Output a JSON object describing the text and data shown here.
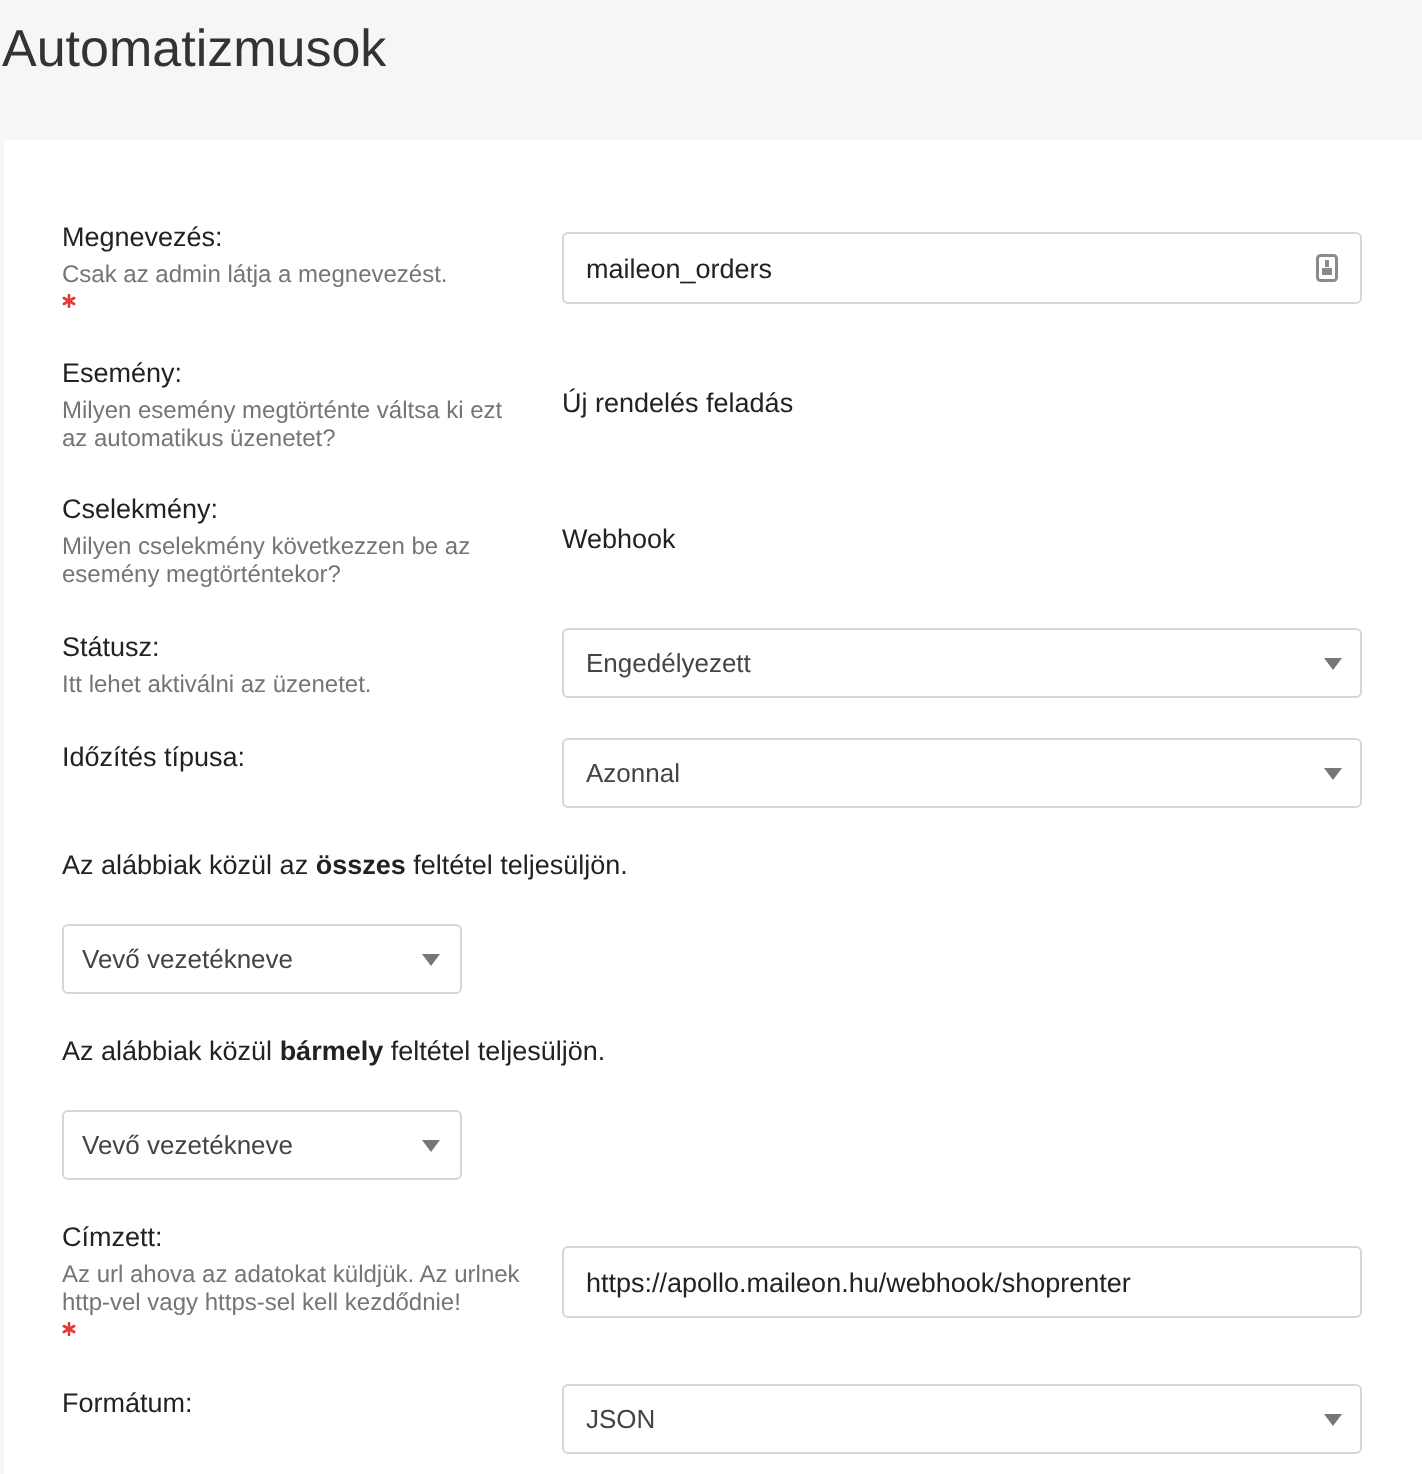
{
  "page": {
    "title": "Automatizmusok"
  },
  "form": {
    "rows": [
      {
        "kind": "text_input",
        "label": "Megnevezés:",
        "description": "Csak az admin látja a megnevezést.",
        "required": true,
        "value": "maileon_orders",
        "autofill_icon": true
      },
      {
        "kind": "static",
        "label": "Esemény:",
        "description": "Milyen esemény megtörténte váltsa ki ezt az automatikus üzenetet?",
        "required": false,
        "value": "Új rendelés feladás"
      },
      {
        "kind": "static",
        "label": "Cselekmény:",
        "description": "Milyen cselekmény következzen be az esemény megtörténtekor?",
        "required": false,
        "value": "Webhook"
      },
      {
        "kind": "select",
        "label": "Státusz:",
        "description": "Itt lehet aktiválni az üzenetet.",
        "required": false,
        "value": "Engedélyezett"
      },
      {
        "kind": "select",
        "label": "Időzítés típusa:",
        "required": false,
        "value": "Azonnal"
      },
      {
        "kind": "condition",
        "text": "Az alábbiak közül az **összes** feltétel teljesüljön.",
        "value": "Vevő vezetékneve"
      },
      {
        "kind": "condition",
        "text": "Az alábbiak közül **bármely** feltétel teljesüljön.",
        "value": "Vevő vezetékneve"
      },
      {
        "kind": "text_input",
        "label": "Címzett:",
        "description": "Az url ahova az adatokat küldjük. Az urlnek http-vel vagy https-sel kell kezdődnie!",
        "required": true,
        "value": "https://apollo.maileon.hu/webhook/shoprenter",
        "autofill_icon": false
      },
      {
        "kind": "select",
        "label": "Formátum:",
        "required": false,
        "value": "JSON"
      }
    ]
  }
}
